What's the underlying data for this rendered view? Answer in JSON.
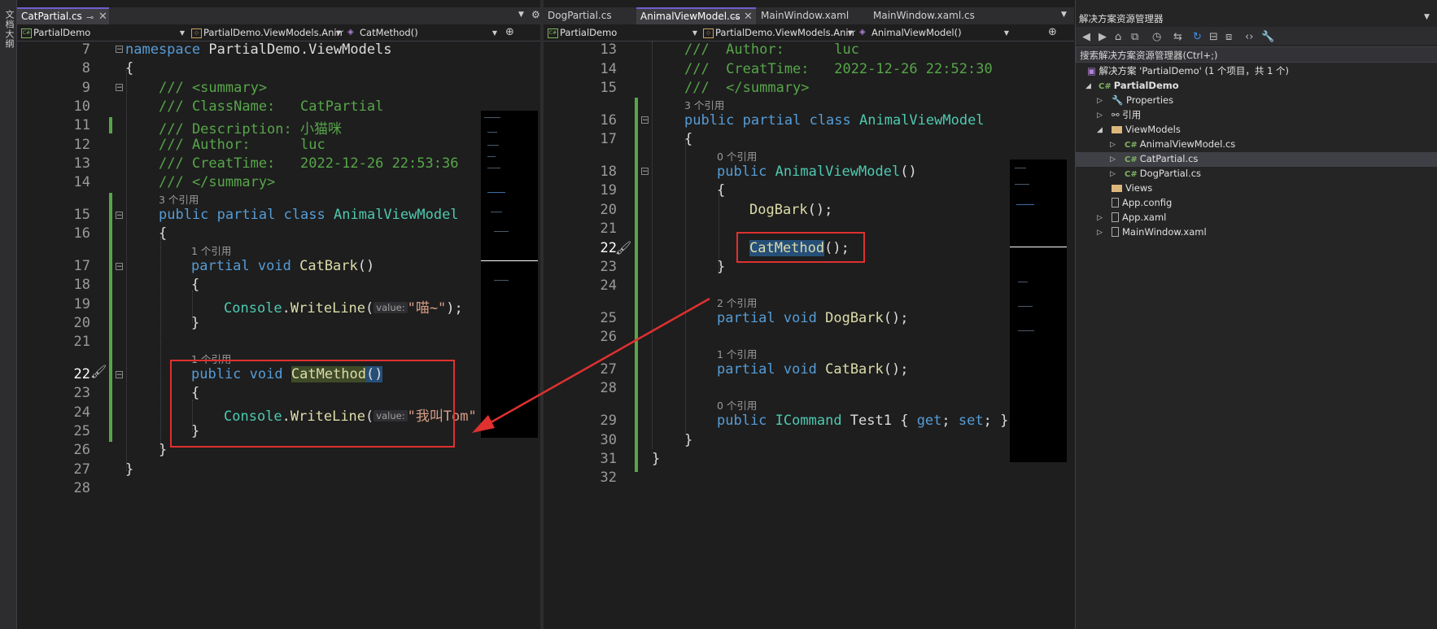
{
  "side_strip": {
    "label": "文档大纲"
  },
  "left_pane": {
    "tabs": [
      {
        "label": "CatPartial.cs",
        "active": true
      }
    ],
    "nav": {
      "project": "PartialDemo",
      "class": "PartialDemo.ViewModels.Animal",
      "member": "CatMethod()"
    },
    "lines": [
      "7",
      "8",
      "9",
      "10",
      "11",
      "12",
      "13",
      "14",
      "15",
      "16",
      "17",
      "18",
      "19",
      "20",
      "21",
      "22",
      "23",
      "24",
      "25",
      "26",
      "27",
      "28"
    ],
    "refs": {
      "class": "3 个引用",
      "catbark": "1 个引用",
      "catmethod": "1 个引用"
    },
    "code": {
      "ns_kw": "namespace",
      "ns_name": " PartialDemo.ViewModels",
      "brace_open": "{",
      "brace_close": "}",
      "summary_open": "/// <summary>",
      "classname": "/// ClassName:   CatPartial",
      "description": "/// Description: 小猫咪",
      "author": "/// Author:      luc",
      "creattime": "/// CreatTime:   2022-12-26 22:53:36",
      "summary_close": "/// </summary>",
      "kw_public": "public",
      "kw_partial": "partial",
      "kw_class": "class",
      "kw_void": "void",
      "class_name": "AnimalViewModel",
      "catbark": "CatBark",
      "parens": "()",
      "console": "Console",
      "writeline": "WriteLine",
      "hint_value": "value:",
      "str_meow": "\"喵~\"",
      "end_stmt": ");",
      "catmethod": "CatMethod",
      "str_tom": "\"我叫Tom\""
    }
  },
  "right_pane": {
    "tabs": [
      {
        "label": "DogPartial.cs",
        "active": false
      },
      {
        "label": "AnimalViewModel.cs",
        "active": true
      },
      {
        "label": "MainWindow.xaml",
        "active": false
      },
      {
        "label": "MainWindow.xaml.cs",
        "active": false
      }
    ],
    "nav": {
      "project": "PartialDemo",
      "class": "PartialDemo.ViewModels.Anima",
      "member": "AnimalViewModel()"
    },
    "lines": [
      "13",
      "14",
      "15",
      "16",
      "17",
      "18",
      "19",
      "20",
      "21",
      "22",
      "23",
      "24",
      "25",
      "26",
      "27",
      "28",
      "29",
      "30",
      "31",
      "32"
    ],
    "refs": {
      "class": "3 个引用",
      "ctor": "0 个引用",
      "dogbark": "2 个引用",
      "catbark": "1 个引用",
      "test1": "0 个引用"
    },
    "code": {
      "author": "///  Author:      luc",
      "creattime": "///  CreatTime:   2022-12-26 22:52:30",
      "summary_close": "///  </summary>",
      "kw_public": "public",
      "kw_partial": "partial",
      "kw_class": "class",
      "kw_void": "void",
      "class_name": "AnimalViewModel",
      "ctor_name": "AnimalViewModel",
      "parens": "()",
      "brace_open": "{",
      "brace_close": "}",
      "dogbark_call": "DogBark",
      "end_call": "();",
      "catmethod": "CatMethod",
      "dogbark": "DogBark",
      "catbark": "CatBark",
      "icommand": "ICommand",
      "test1": " Test1 { ",
      "kw_get": "get",
      "semi": "; ",
      "kw_set": "set",
      "close_prop": "; }"
    }
  },
  "solution_explorer": {
    "title": "解决方案资源管理器",
    "search_placeholder": "搜索解决方案资源管理器(Ctrl+;)",
    "solution": "解决方案 'PartialDemo' (1 个项目，共 1 个)",
    "project": "PartialDemo",
    "items": [
      "Properties",
      "引用",
      "ViewModels",
      "AnimalViewModel.cs",
      "CatPartial.cs",
      "DogPartial.cs",
      "Views",
      "App.config",
      "App.xaml",
      "MainWindow.xaml"
    ]
  },
  "colors": {
    "keyword": "#569cd6",
    "type": "#4ec9b0",
    "method": "#dcdcaa",
    "string": "#d69d85",
    "comment": "#57a64a",
    "annotation": "#e03030"
  }
}
